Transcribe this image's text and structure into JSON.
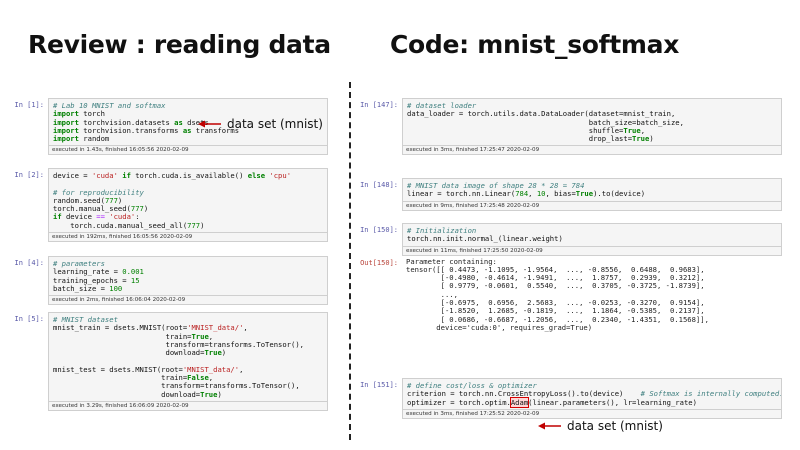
{
  "headings": {
    "left": "Review : reading data",
    "right": "Code: mnist_softmax"
  },
  "annotations": {
    "data_set_1": "data set (mnist)",
    "data_set_2": "data set (mnist)"
  },
  "colors": {
    "arrow": "#c00000",
    "highlight": "#d40000"
  },
  "left_cells": [
    {
      "prompt": "In [1]:",
      "exec": "executed in 1.43s, finished 16:05:56 2020-02-09"
    },
    {
      "prompt": "In [2]:",
      "exec": "executed in 192ms, finished 16:05:56 2020-02-09"
    },
    {
      "prompt": "In [4]:",
      "exec": "executed in 2ms, finished 16:06:04 2020-02-09"
    },
    {
      "prompt": "In [5]:",
      "exec": "executed in 3.29s, finished 16:06:09 2020-02-09"
    }
  ],
  "right_cells": [
    {
      "prompt": "In [147]:",
      "exec": "executed in 3ms, finished 17:25:47 2020-02-09"
    },
    {
      "prompt": "In [148]:",
      "exec": "executed in 9ms, finished 17:25:48 2020-02-09"
    },
    {
      "prompt": "In [150]:",
      "exec": "executed in 11ms, finished 17:25:50 2020-02-09",
      "out_prompt": "Out[150]:"
    },
    {
      "prompt": "In [151]:",
      "exec": "executed in 3ms, finished 17:25:52 2020-02-09"
    }
  ]
}
